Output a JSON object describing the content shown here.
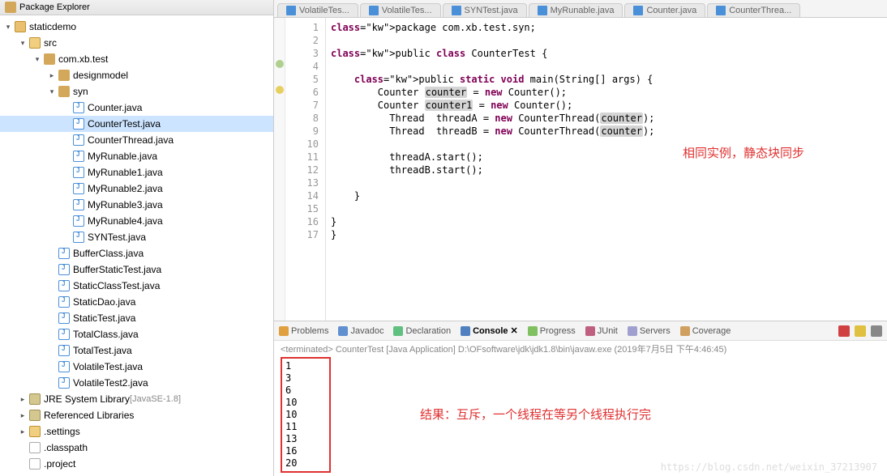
{
  "explorer": {
    "title": "Package Explorer",
    "tree": [
      {
        "label": "staticdemo",
        "icon": "project",
        "indent": 0,
        "expand": "open"
      },
      {
        "label": "src",
        "icon": "folder",
        "indent": 1,
        "expand": "open"
      },
      {
        "label": "com.xb.test",
        "icon": "package",
        "indent": 2,
        "expand": "open"
      },
      {
        "label": "designmodel",
        "icon": "package",
        "indent": 3,
        "expand": "closed"
      },
      {
        "label": "syn",
        "icon": "package",
        "indent": 3,
        "expand": "open"
      },
      {
        "label": "Counter.java",
        "icon": "java",
        "indent": 4,
        "expand": "leaf"
      },
      {
        "label": "CounterTest.java",
        "icon": "java",
        "indent": 4,
        "expand": "leaf",
        "selected": true
      },
      {
        "label": "CounterThread.java",
        "icon": "java",
        "indent": 4,
        "expand": "leaf"
      },
      {
        "label": "MyRunable.java",
        "icon": "java",
        "indent": 4,
        "expand": "leaf"
      },
      {
        "label": "MyRunable1.java",
        "icon": "java",
        "indent": 4,
        "expand": "leaf"
      },
      {
        "label": "MyRunable2.java",
        "icon": "java",
        "indent": 4,
        "expand": "leaf"
      },
      {
        "label": "MyRunable3.java",
        "icon": "java",
        "indent": 4,
        "expand": "leaf"
      },
      {
        "label": "MyRunable4.java",
        "icon": "java",
        "indent": 4,
        "expand": "leaf"
      },
      {
        "label": "SYNTest.java",
        "icon": "java",
        "indent": 4,
        "expand": "leaf"
      },
      {
        "label": "BufferClass.java",
        "icon": "java",
        "indent": 3,
        "expand": "leaf"
      },
      {
        "label": "BufferStaticTest.java",
        "icon": "java",
        "indent": 3,
        "expand": "leaf"
      },
      {
        "label": "StaticClassTest.java",
        "icon": "java",
        "indent": 3,
        "expand": "leaf"
      },
      {
        "label": "StaticDao.java",
        "icon": "java",
        "indent": 3,
        "expand": "leaf"
      },
      {
        "label": "StaticTest.java",
        "icon": "java",
        "indent": 3,
        "expand": "leaf"
      },
      {
        "label": "TotalClass.java",
        "icon": "java",
        "indent": 3,
        "expand": "leaf"
      },
      {
        "label": "TotalTest.java",
        "icon": "java",
        "indent": 3,
        "expand": "leaf"
      },
      {
        "label": "VolatileTest.java",
        "icon": "java",
        "indent": 3,
        "expand": "leaf"
      },
      {
        "label": "VolatileTest2.java",
        "icon": "java",
        "indent": 3,
        "expand": "leaf"
      },
      {
        "label": "JRE System Library",
        "labelExtra": "[JavaSE-1.8]",
        "icon": "lib",
        "indent": 1,
        "expand": "closed"
      },
      {
        "label": "Referenced Libraries",
        "icon": "lib",
        "indent": 1,
        "expand": "closed"
      },
      {
        "label": ".settings",
        "icon": "folder",
        "indent": 1,
        "expand": "closed"
      },
      {
        "label": ".classpath",
        "icon": "file",
        "indent": 1,
        "expand": "none"
      },
      {
        "label": ".project",
        "icon": "file",
        "indent": 1,
        "expand": "none"
      }
    ]
  },
  "editorTabs": [
    {
      "label": "VolatileTes..."
    },
    {
      "label": "VolatileTes..."
    },
    {
      "label": "SYNTest.java"
    },
    {
      "label": "MyRunable.java"
    },
    {
      "label": "Counter.java"
    },
    {
      "label": "CounterThrea..."
    }
  ],
  "code": {
    "lines": [
      "1",
      "2",
      "3",
      "4",
      "5",
      "6",
      "7",
      "8",
      "9",
      "10",
      "11",
      "12",
      "13",
      "14",
      "15",
      "16",
      "17"
    ],
    "content": "package com.xb.test.syn;\n\npublic class CounterTest {\n\n    public static void main(String[] args) {\n        Counter counter = new Counter();\n        Counter counter1 = new Counter();\n          Thread  threadA = new CounterThread(counter);\n          Thread  threadB = new CounterThread(counter);\n\n          threadA.start();\n          threadB.start();\n\n    }\n\n}\n}",
    "annotation": "相同实例，静态块同步"
  },
  "bottomTabs": {
    "problems": "Problems",
    "javadoc": "Javadoc",
    "declaration": "Declaration",
    "console": "Console",
    "progress": "Progress",
    "junit": "JUnit",
    "servers": "Servers",
    "coverage": "Coverage"
  },
  "console": {
    "header": "<terminated> CounterTest [Java Application] D:\\OFsoftware\\jdk\\jdk1.8\\bin\\javaw.exe (2019年7月5日 下午4:46:45)",
    "output": [
      "1",
      "3",
      "6",
      "10",
      "10",
      "11",
      "13",
      "16",
      "20"
    ],
    "annotation": "结果：互斥，一个线程在等另个线程执行完"
  },
  "watermark": "https://blog.csdn.net/weixin_37213907"
}
